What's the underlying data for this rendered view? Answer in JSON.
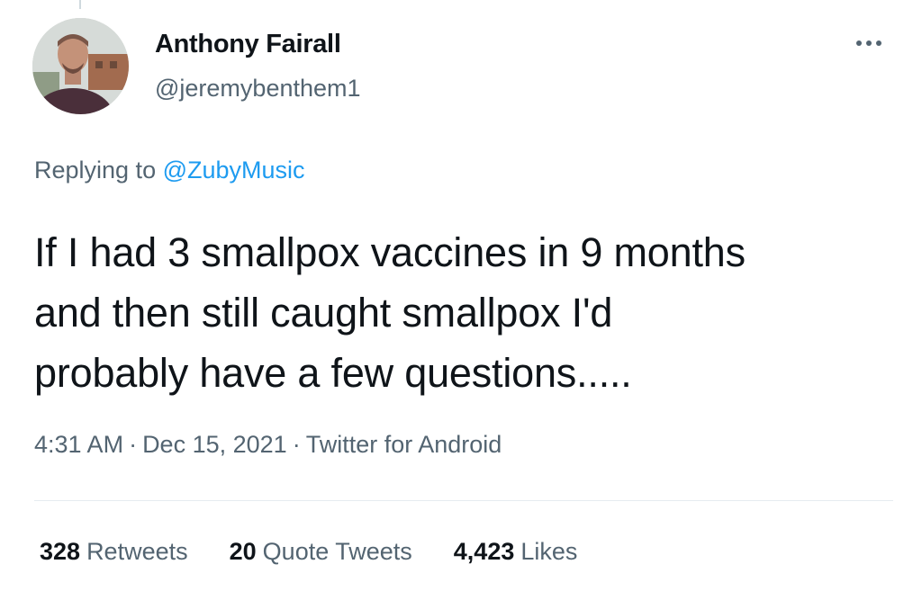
{
  "tweet": {
    "author": {
      "display_name": "Anthony Fairall",
      "handle": "@jeremybenthem1"
    },
    "replying_to": {
      "prefix": "Replying to",
      "handle": "@ZubyMusic"
    },
    "text_lines": [
      "If I had 3 smallpox vaccines in 9 months",
      "and then still caught smallpox I'd",
      "probably have a few questions....."
    ],
    "meta": {
      "time": "4:31 AM",
      "separator": "·",
      "date": "Dec 15, 2021",
      "source": "Twitter for Android"
    },
    "stats": {
      "retweets": {
        "count": "328",
        "label": "Retweets"
      },
      "quote_tweets": {
        "count": "20",
        "label": "Quote Tweets"
      },
      "likes": {
        "count": "4,423",
        "label": "Likes"
      }
    }
  },
  "icons": {
    "more": "more-horizontal-icon"
  },
  "colors": {
    "link": "#1d9bf0",
    "secondary_text": "#536471",
    "primary_text": "#0f1419"
  }
}
